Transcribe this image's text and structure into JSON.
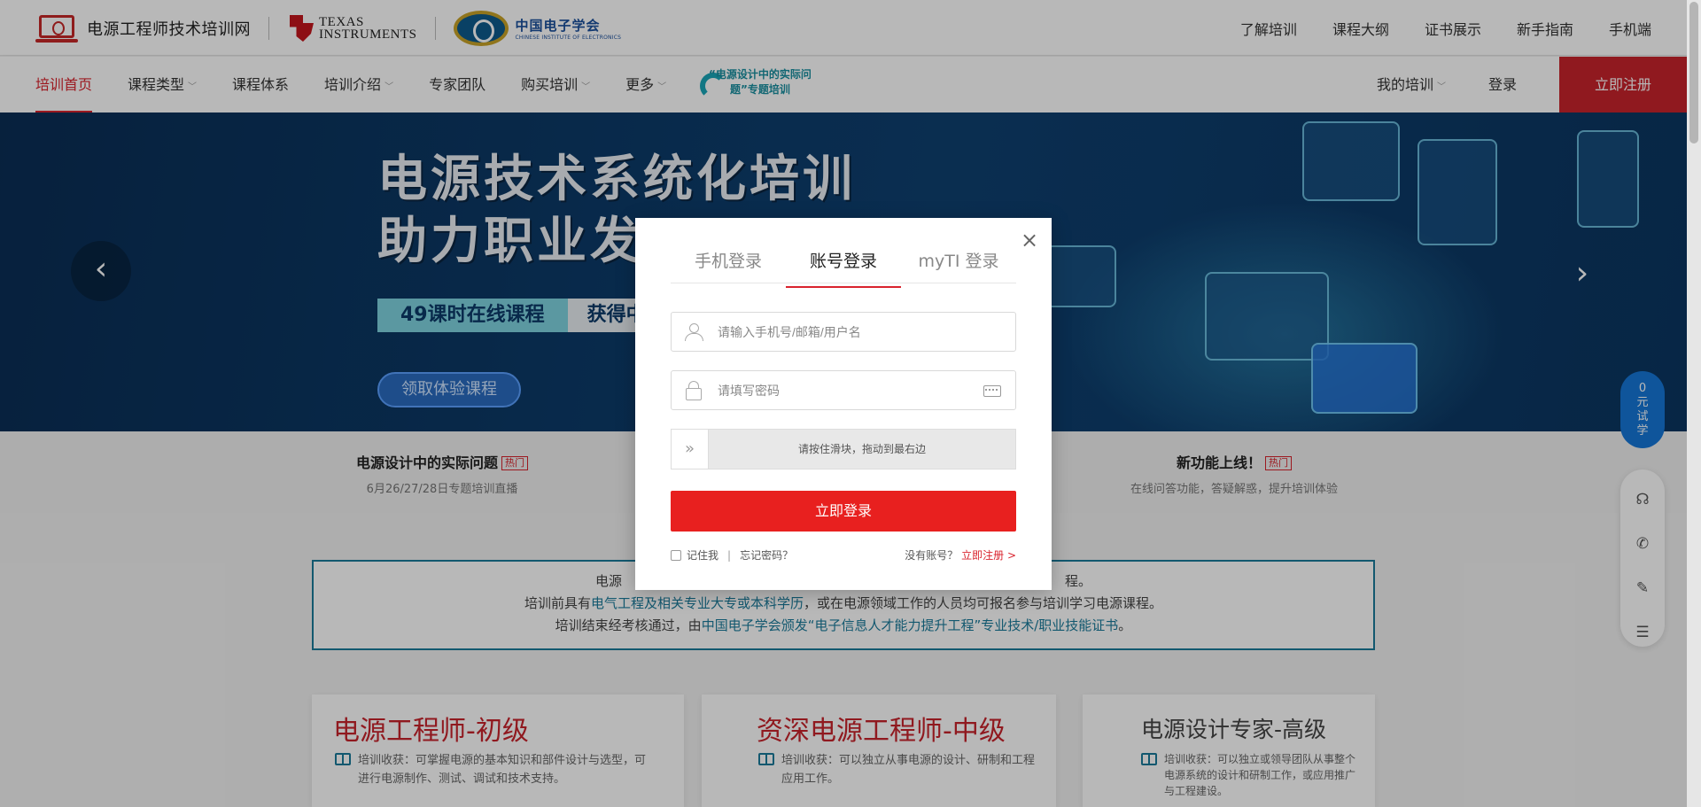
{
  "brand": {
    "site_name": "电源工程师技术培训网",
    "ti_line1": "TEXAS",
    "ti_line2": "INSTRUMENTS",
    "cie_cn": "中国电子学会",
    "cie_en": "CHINESE INSTITUTE OF ELECTRONICS"
  },
  "top_links": [
    "了解培训",
    "课程大纲",
    "证书展示",
    "新手指南",
    "手机端"
  ],
  "nav": {
    "items": [
      {
        "label": "培训首页",
        "dropdown": false,
        "active": true
      },
      {
        "label": "课程类型",
        "dropdown": true
      },
      {
        "label": "课程体系",
        "dropdown": false
      },
      {
        "label": "培训介绍",
        "dropdown": true
      },
      {
        "label": "专家团队",
        "dropdown": false
      },
      {
        "label": "购买培训",
        "dropdown": true
      },
      {
        "label": "更多",
        "dropdown": true
      }
    ],
    "promo_text": "“电源设计中的实际问题”专题培训",
    "my_training": "我的培训",
    "login": "登录",
    "register": "立即注册"
  },
  "hero": {
    "title_line1": "电源技术系统化培训",
    "title_line2": "助力职业发",
    "badge1": "49课时在线课程",
    "badge2": "获得中",
    "cta": "领取体验课程",
    "prev_icon": "chevron-left-icon",
    "next_icon": "chevron-right-icon"
  },
  "strip": [
    {
      "title": "电源设计中的实际问题",
      "tag": "热门",
      "sub": "6月26/27/28日专题培训直播"
    },
    {
      "title": "新功能上线！",
      "tag": "热门",
      "sub": "在线问答功能，答疑解惑，提升培训体验"
    }
  ],
  "intro": {
    "line1_start": "电源",
    "line1_end": "程。",
    "line2_a": "培训前具有",
    "line2_hl": "电气工程及相关专业大专或本科学历",
    "line2_b": "，或在电源领域工作的人员均可报名参与培训学习电源课程。",
    "line3_a": "培训结束经考核通过，由",
    "line3_hl": "中国电子学会颁发“电子信息人才能力提升工程”专业技术/职业技能证书",
    "line3_b": "。"
  },
  "cards": [
    {
      "title": "电源工程师-初级",
      "desc1": "培训收获：可掌握电源的基本知识和部件设计与选型，可",
      "desc2": "进行电源制作、测试、调试和技术支持。"
    },
    {
      "title": "资深电源工程师-中级",
      "desc1": "培训收获：可以独立从事电源的设计、研制和工程",
      "desc2": "应用工作。"
    },
    {
      "title": "电源设计专家-高级",
      "desc1": "培训收获：可以独立或领导团队从事整个",
      "desc2": "电源系统的设计和研制工作，或应用推广",
      "desc3": "与工程建设。"
    }
  ],
  "side": {
    "trial": [
      "0",
      "元",
      "试",
      "学"
    ],
    "tools": [
      "headset-icon",
      "phone-icon",
      "edit-icon",
      "document-icon"
    ]
  },
  "modal": {
    "tabs": [
      "手机登录",
      "账号登录",
      "myTI 登录"
    ],
    "active_tab": "账号登录",
    "username_placeholder": "请输入手机号/邮箱/用户名",
    "password_placeholder": "请填写密码",
    "slider_text": "请按住滑块，拖动到最右边",
    "slider_handle": "»",
    "login_button": "立即登录",
    "remember": "记住我",
    "divider": "|",
    "forgot": "忘记密码？",
    "no_account": "没有账号？",
    "signup_link": "立即注册 >",
    "close": "×"
  }
}
